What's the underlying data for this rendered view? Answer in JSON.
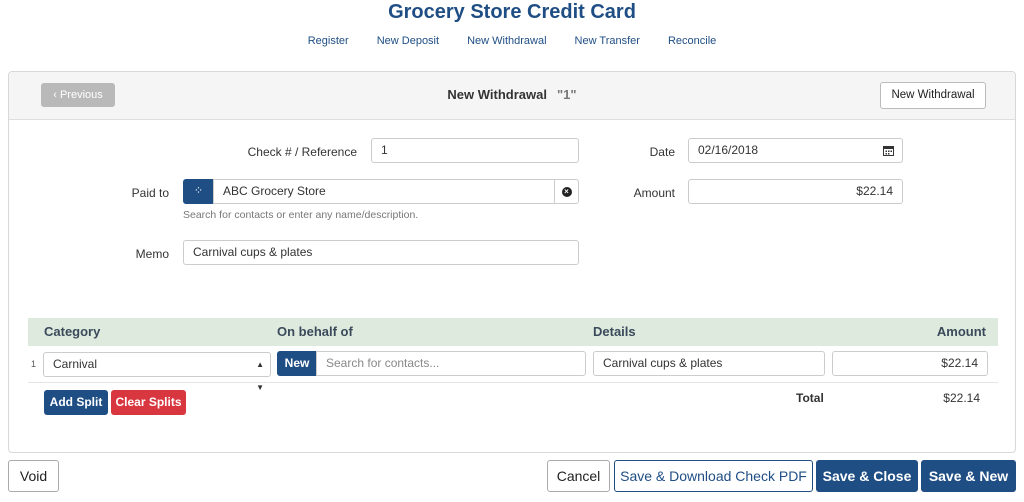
{
  "page": {
    "title": "Grocery Store Credit Card"
  },
  "nav": {
    "items": [
      "Register",
      "New Deposit",
      "New Withdrawal",
      "New Transfer",
      "Reconcile"
    ]
  },
  "header": {
    "previous_label": "Previous",
    "title": "New Withdrawal",
    "number": "\"1\"",
    "new_withdrawal_label": "New Withdrawal"
  },
  "form": {
    "check_label": "Check # / Reference",
    "check_value": "1",
    "date_label": "Date",
    "date_value": "02/16/2018",
    "paid_to_label": "Paid to",
    "paid_to_value": "ABC Grocery Store",
    "paid_to_help": "Search for contacts or enter any name/description.",
    "amount_label": "Amount",
    "amount_value": "$22.14",
    "memo_label": "Memo",
    "memo_value": "Carnival cups & plates"
  },
  "splits": {
    "headers": {
      "category": "Category",
      "on_behalf_of": "On behalf of",
      "details": "Details",
      "amount": "Amount"
    },
    "rows": [
      {
        "num": "1",
        "category": "Carnival",
        "new_label": "New",
        "contact_placeholder": "Search for contacts...",
        "details": "Carnival cups & plates",
        "amount": "$22.14"
      }
    ],
    "add_split_label": "Add Split",
    "clear_splits_label": "Clear Splits",
    "total_label": "Total",
    "total_value": "$22.14"
  },
  "footer": {
    "void_label": "Void",
    "cancel_label": "Cancel",
    "save_pdf_label": "Save & Download Check PDF",
    "save_close_label": "Save & Close",
    "save_new_label": "Save & New"
  },
  "colors": {
    "primary": "#1f4e85",
    "danger": "#d8373f",
    "split_header_bg": "#dfeadf"
  },
  "icons": [
    "chevron-left-icon",
    "calendar-icon",
    "spinner-icon",
    "clear-icon",
    "sort-arrows-icon"
  ]
}
